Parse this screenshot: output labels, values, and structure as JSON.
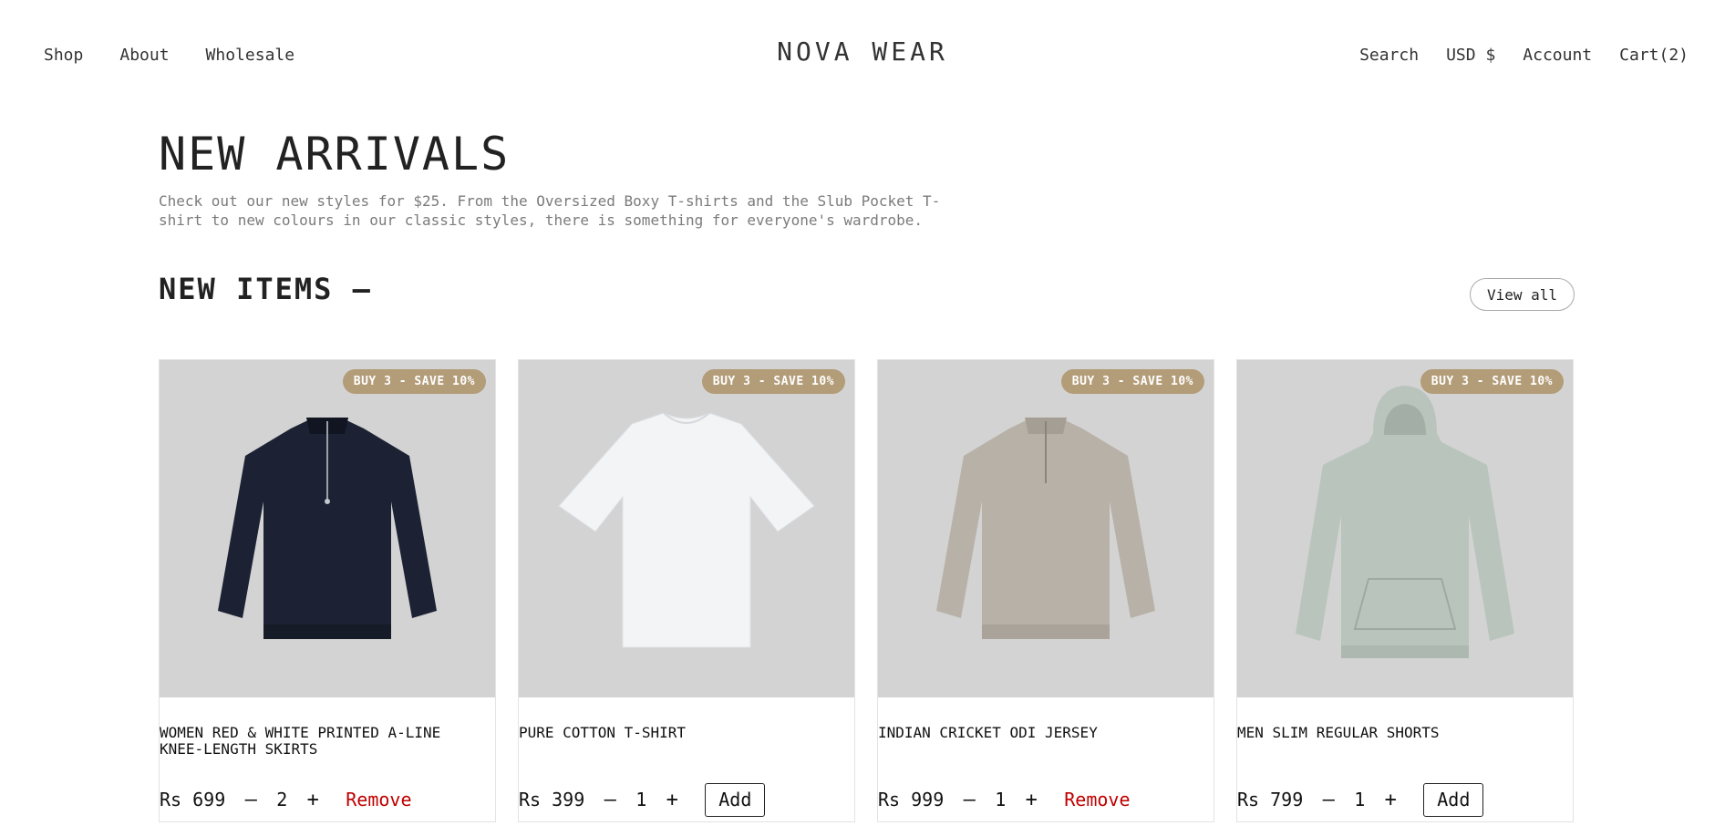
{
  "nav": {
    "left": [
      "Shop",
      "About",
      "Wholesale"
    ],
    "brand": "NOVA WEAR",
    "search": "Search",
    "currency": "USD $",
    "account": "Account",
    "cart": "Cart(2)"
  },
  "hero": {
    "title": "NEW ARRIVALS",
    "description": "Check out our new styles for $25. From the Oversized Boxy T-shirts and the Slub Pocket T-shirt to new colours in our classic styles, there is something for everyone's wardrobe."
  },
  "section": {
    "title": "NEW ITEMS —",
    "view_all": "View all"
  },
  "products": [
    {
      "badge": "BUY 3 - SAVE 10%",
      "name": "WOMEN RED & WHITE PRINTED A-LINE KNEE-LENGTH SKIRTS",
      "price": "Rs 699",
      "qty": "2",
      "action": "Remove",
      "minus": "—",
      "plus": "+",
      "image": "navy-quarter-zip-sweatshirt",
      "color": "#1c2233"
    },
    {
      "badge": "BUY 3 - SAVE 10%",
      "name": "PURE COTTON T-SHIRT",
      "price": "Rs 399",
      "qty": "1",
      "action": "Add",
      "minus": "—",
      "plus": "+",
      "image": "white-tshirt",
      "color": "#f3f4f6"
    },
    {
      "badge": "BUY 3 - SAVE 10%",
      "name": "INDIAN CRICKET ODI JERSEY",
      "price": "Rs 999",
      "qty": "1",
      "action": "Remove",
      "minus": "—",
      "plus": "+",
      "image": "grey-quarter-zip-sweatshirt",
      "color": "#b8b1a8"
    },
    {
      "badge": "BUY 3 - SAVE 10%",
      "name": "MEN SLIM REGULAR SHORTS",
      "price": "Rs 799",
      "qty": "1",
      "action": "Add",
      "minus": "—",
      "plus": "+",
      "image": "sage-hoodie",
      "color": "#b9c4bd"
    }
  ]
}
